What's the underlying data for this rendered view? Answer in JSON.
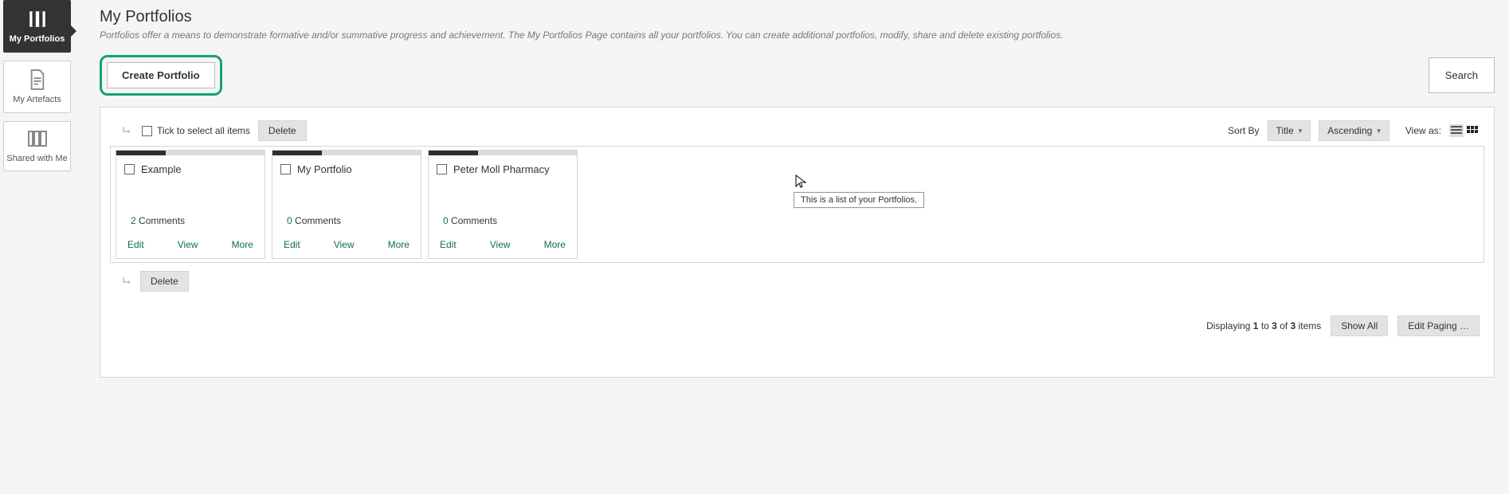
{
  "sidebar": {
    "items": [
      {
        "label": "My Portfolios"
      },
      {
        "label": "My Artefacts"
      },
      {
        "label": "Shared with Me"
      }
    ]
  },
  "header": {
    "title": "My Portfolios",
    "description": "Portfolios offer a means to demonstrate formative and/or summative progress and achievement. The My Portfolios Page contains all your portfolios. You can create additional portfolios, modify, share and delete existing portfolios."
  },
  "toolbar": {
    "create_label": "Create Portfolio",
    "search_label": "Search"
  },
  "list": {
    "select_all_label": "Tick to select all items",
    "delete_label": "Delete",
    "sort_by_label": "Sort By",
    "sort_field": "Title",
    "sort_dir": "Ascending",
    "view_as_label": "View as:"
  },
  "cards": [
    {
      "title": "Example",
      "comments_count": "2",
      "comments_word": "Comments",
      "edit": "Edit",
      "view": "View",
      "more": "More"
    },
    {
      "title": "My Portfolio",
      "comments_count": "0",
      "comments_word": "Comments",
      "edit": "Edit",
      "view": "View",
      "more": "More"
    },
    {
      "title": "Peter Moll Pharmacy",
      "comments_count": "0",
      "comments_word": "Comments",
      "edit": "Edit",
      "view": "View",
      "more": "More"
    }
  ],
  "tooltip": {
    "text": "This is a list of your Portfolios."
  },
  "paging": {
    "prefix": "Displaying ",
    "from": "1",
    "to_word": " to ",
    "to": "3",
    "of_word": " of ",
    "total": "3",
    "suffix": " items",
    "show_all": "Show All",
    "edit_paging": "Edit Paging …"
  }
}
